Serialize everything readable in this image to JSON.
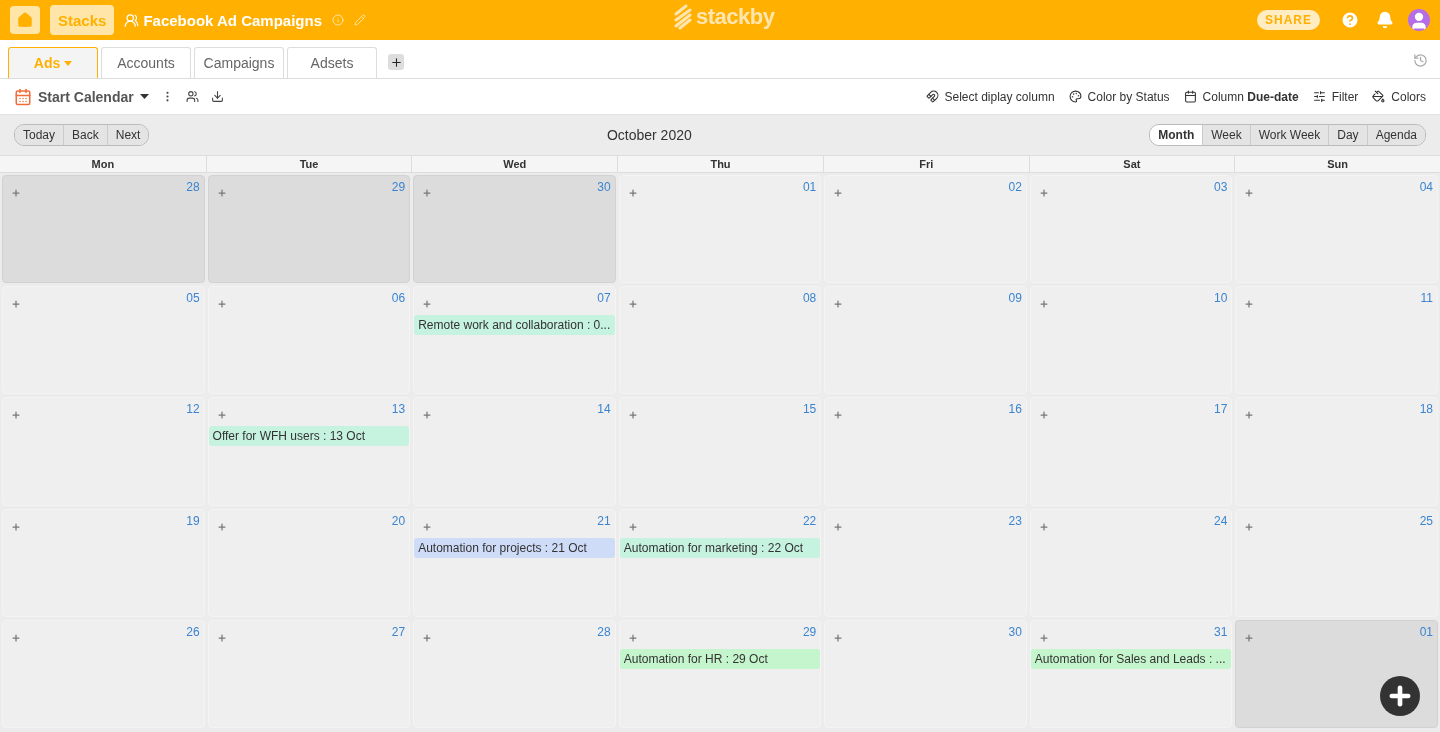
{
  "header": {
    "stacks_button": "Stacks",
    "title": "Facebook Ad Campaigns",
    "logo_text": "stackby",
    "share_button": "SHARE"
  },
  "tabs": [
    {
      "label": "Ads",
      "selected": true
    },
    {
      "label": "Accounts",
      "selected": false
    },
    {
      "label": "Campaigns",
      "selected": false
    },
    {
      "label": "Adsets",
      "selected": false
    }
  ],
  "toolbar": {
    "view_name": "Start Calendar",
    "options": [
      {
        "kind": "magnet",
        "label": "Select diplay column"
      },
      {
        "kind": "palette",
        "label": "Color by Status"
      },
      {
        "kind": "calendar",
        "label": "Column **Due-date**"
      },
      {
        "kind": "filter",
        "label": "Filter"
      },
      {
        "kind": "bucket",
        "label": "Colors"
      }
    ]
  },
  "calendar": {
    "nav_buttons": [
      "Today",
      "Back",
      "Next"
    ],
    "title": "October 2020",
    "views": [
      {
        "label": "Month",
        "selected": true
      },
      {
        "label": "Week",
        "selected": false
      },
      {
        "label": "Work Week",
        "selected": false
      },
      {
        "label": "Day",
        "selected": false
      },
      {
        "label": "Agenda",
        "selected": false
      }
    ],
    "weekdays": [
      "Mon",
      "Tue",
      "Wed",
      "Thu",
      "Fri",
      "Sat",
      "Sun"
    ],
    "days": [
      {
        "date": "28",
        "other_month": true
      },
      {
        "date": "29",
        "other_month": true
      },
      {
        "date": "30",
        "other_month": true
      },
      {
        "date": "01",
        "other_month": false
      },
      {
        "date": "02",
        "other_month": false
      },
      {
        "date": "03",
        "other_month": false
      },
      {
        "date": "04",
        "other_month": false
      },
      {
        "date": "05",
        "other_month": false
      },
      {
        "date": "06",
        "other_month": false
      },
      {
        "date": "07",
        "other_month": false,
        "events": [
          {
            "label": "Remote work and collaboration : 0...",
            "color": "#c6f2e0"
          }
        ]
      },
      {
        "date": "08",
        "other_month": false
      },
      {
        "date": "09",
        "other_month": false
      },
      {
        "date": "10",
        "other_month": false
      },
      {
        "date": "11",
        "other_month": false
      },
      {
        "date": "12",
        "other_month": false
      },
      {
        "date": "13",
        "other_month": false,
        "events": [
          {
            "label": "Offer for WFH users : 13 Oct",
            "color": "#c6f2e0"
          }
        ]
      },
      {
        "date": "14",
        "other_month": false
      },
      {
        "date": "15",
        "other_month": false
      },
      {
        "date": "16",
        "other_month": false
      },
      {
        "date": "17",
        "other_month": false
      },
      {
        "date": "18",
        "other_month": false
      },
      {
        "date": "19",
        "other_month": false
      },
      {
        "date": "20",
        "other_month": false
      },
      {
        "date": "21",
        "other_month": false,
        "events": [
          {
            "label": "Automation for projects : 21 Oct",
            "color": "#cfdcf8"
          }
        ]
      },
      {
        "date": "22",
        "other_month": false,
        "events": [
          {
            "label": "Automation for marketing : 22 Oct",
            "color": "#c6f2e0"
          }
        ]
      },
      {
        "date": "23",
        "other_month": false
      },
      {
        "date": "24",
        "other_month": false
      },
      {
        "date": "25",
        "other_month": false
      },
      {
        "date": "26",
        "other_month": false
      },
      {
        "date": "27",
        "other_month": false
      },
      {
        "date": "28",
        "other_month": false
      },
      {
        "date": "29",
        "other_month": false,
        "events": [
          {
            "label": "Automation for HR : 29 Oct",
            "color": "#c5f5cc"
          }
        ]
      },
      {
        "date": "30",
        "other_month": false
      },
      {
        "date": "31",
        "other_month": false,
        "events": [
          {
            "label": "Automation for Sales and Leads : ...",
            "color": "#c5f5cc"
          }
        ]
      },
      {
        "date": "01",
        "other_month": true
      }
    ]
  }
}
